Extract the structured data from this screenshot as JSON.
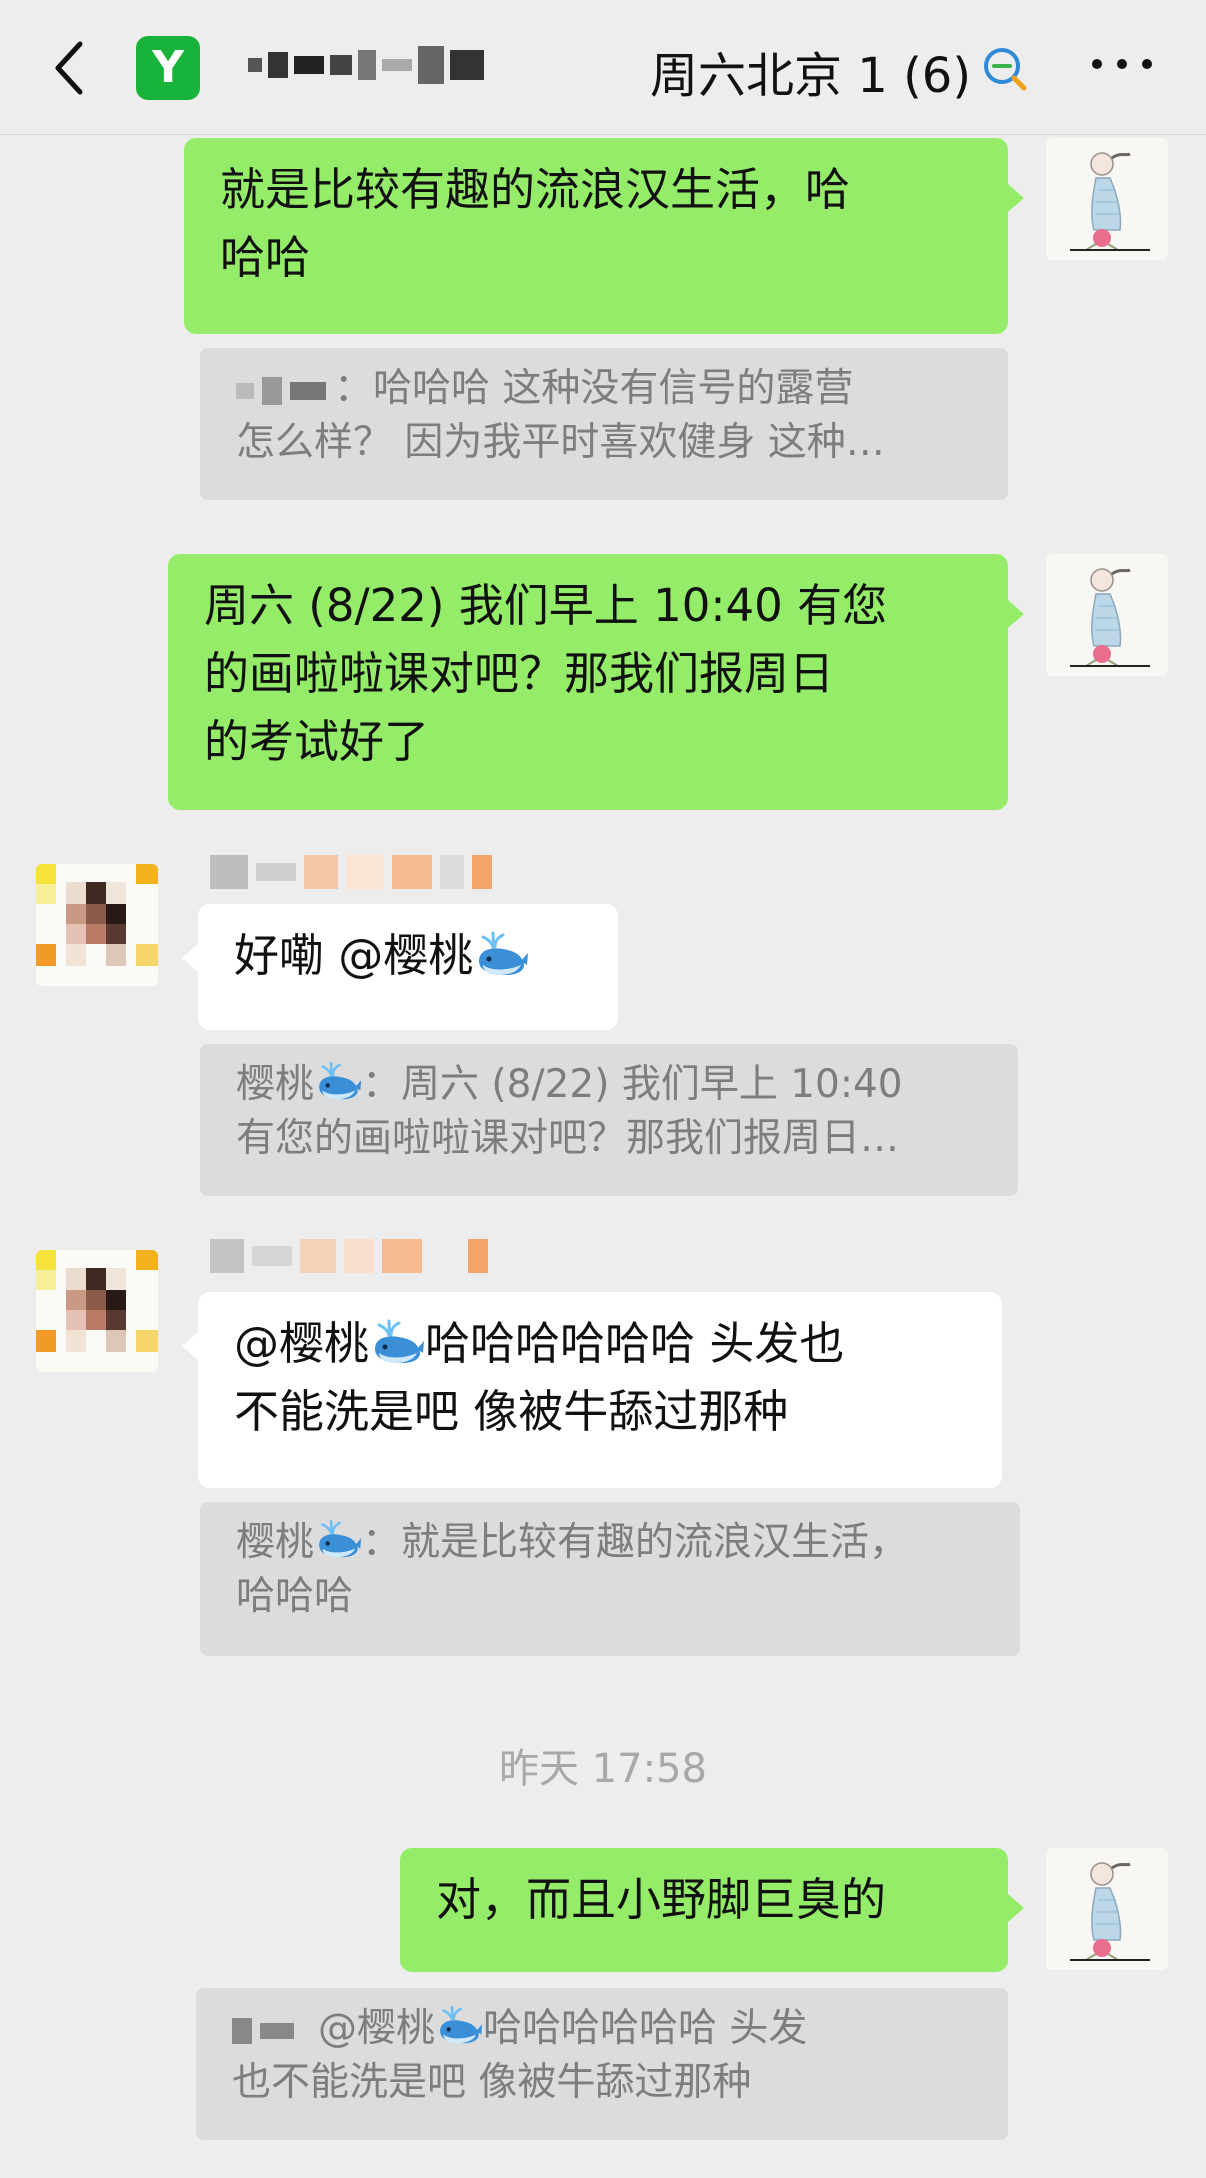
{
  "header": {
    "title": "周六北京 1",
    "member_count": "(6)"
  },
  "messages": [
    {
      "from": "me",
      "text_line1": "就是比较有趣的流浪汉生活，哈",
      "text_line2": "哈哈"
    },
    {
      "quote_line1_tail": "：哈哈哈  这种没有信号的露营",
      "quote_line2": "怎么样？  因为我平时喜欢健身 这种…"
    },
    {
      "from": "me",
      "text_line1": "周六 (8/22) 我们早上 10:40 有您",
      "text_line2": "的画啦啦课对吧？那我们报周日",
      "text_line3": "的考试好了"
    },
    {
      "from": "other",
      "text_prefix": "好嘞 @樱桃"
    },
    {
      "quote_name": "樱桃",
      "quote_line1_tail": "：周六 (8/22) 我们早上 10:40",
      "quote_line2": "有您的画啦啦课对吧？那我们报周日…"
    },
    {
      "from": "other",
      "text_prefix": "@樱桃",
      "text_line1_tail": "哈哈哈哈哈哈 头发也",
      "text_line2": "不能洗是吧 像被牛舔过那种"
    },
    {
      "quote_name": "樱桃",
      "quote_line1_tail": "：就是比较有趣的流浪汉生活，",
      "quote_line2": "哈哈哈"
    },
    {
      "from": "me",
      "text": "对，而且小野脚巨臭的"
    },
    {
      "quote_line1": "@樱桃",
      "quote_line1_tail": "哈哈哈哈哈哈 头发",
      "quote_line2": "也不能洗是吧 像被牛舔过那种"
    }
  ],
  "timestamp": "昨天 17:58",
  "icons": {
    "back": "chevron-left-icon",
    "app": "app-logo-icon",
    "chat_search": "chat-search-icon",
    "more": "more-icon",
    "whale": "whale-emoji-icon"
  },
  "colors": {
    "my_bubble": "#95ec69",
    "their_bubble": "#ffffff",
    "quote_bg": "#dcdcdc",
    "background": "#ededed"
  }
}
